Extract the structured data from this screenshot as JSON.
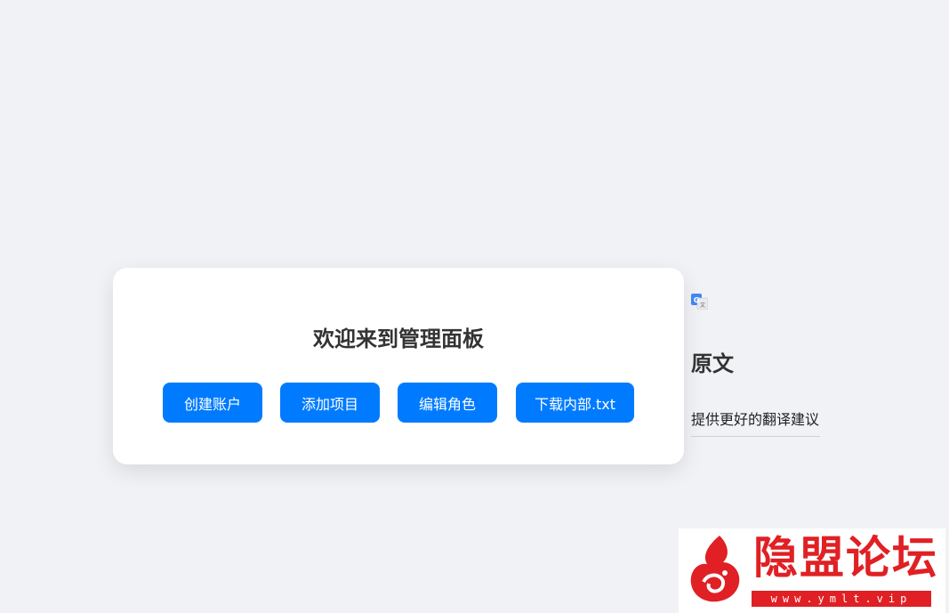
{
  "panel": {
    "title": "欢迎来到管理面板",
    "buttons": [
      {
        "label": "创建账户"
      },
      {
        "label": "添加项目"
      },
      {
        "label": "编辑角色"
      },
      {
        "label": "下载内部.txt"
      }
    ]
  },
  "translate_popup": {
    "icon": "google-translate-icon",
    "original_label": "原文",
    "suggest_link": "提供更好的翻译建议"
  },
  "watermark": {
    "name": "隐盟论坛",
    "url": "www.ymlt.vip"
  },
  "colors": {
    "background": "#f0f2f5",
    "button": "#007bff",
    "watermark_red": "#e02024"
  }
}
